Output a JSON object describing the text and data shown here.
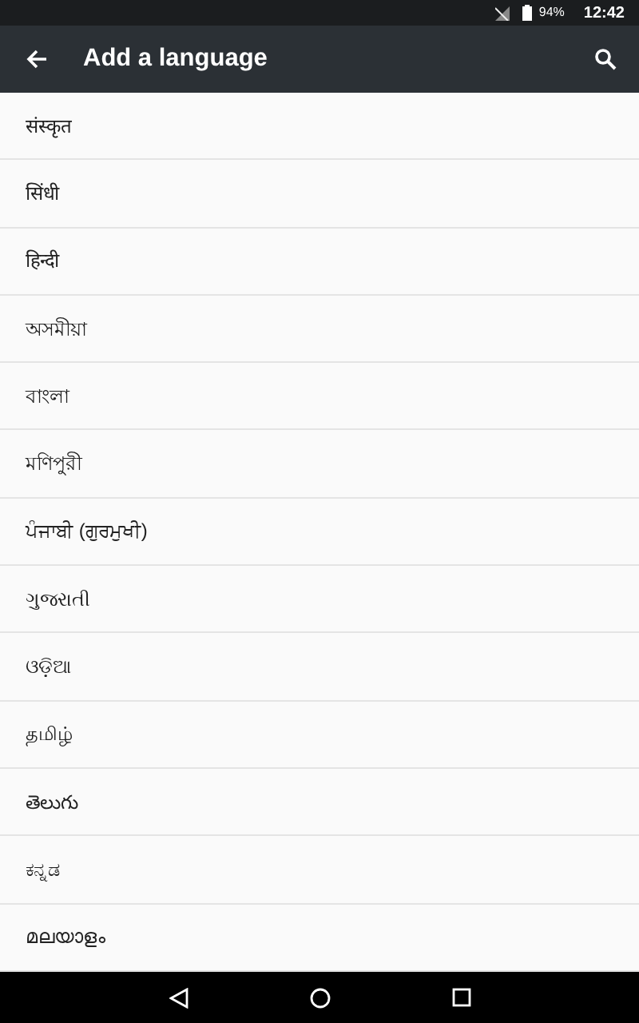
{
  "status_bar": {
    "battery": "94%",
    "time": "12:42"
  },
  "app_bar": {
    "title": "Add a language"
  },
  "languages": [
    {
      "label": "संस्कृत"
    },
    {
      "label": "सिंधी"
    },
    {
      "label": "हिन्दी"
    },
    {
      "label": "অসমীয়া"
    },
    {
      "label": "বাংলা"
    },
    {
      "label": "মণিপুরী"
    },
    {
      "label": "ਪੰਜਾਬੀ (ਗੁਰਮੁਖੀ)"
    },
    {
      "label": "ગુજરાતી"
    },
    {
      "label": "ଓଡ଼ିଆ"
    },
    {
      "label": "தமிழ்"
    },
    {
      "label": "తెలుగు"
    },
    {
      "label": "ಕನ್ನಡ"
    },
    {
      "label": "മലയാളം"
    }
  ]
}
